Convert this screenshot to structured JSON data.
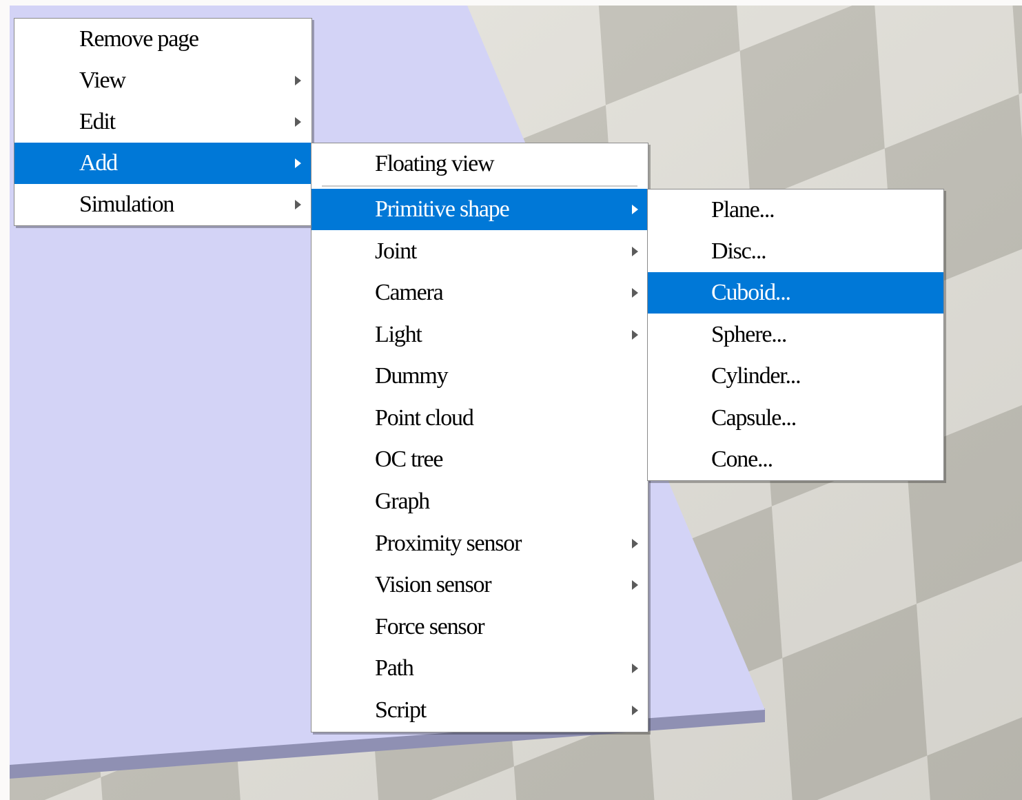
{
  "context_menu": {
    "items": [
      {
        "label": "Remove page",
        "submenu": false,
        "selected": false
      },
      {
        "label": "View",
        "submenu": true,
        "selected": false
      },
      {
        "label": "Edit",
        "submenu": true,
        "selected": false
      },
      {
        "label": "Add",
        "submenu": true,
        "selected": true
      },
      {
        "label": "Simulation",
        "submenu": true,
        "selected": false
      }
    ]
  },
  "add_menu": {
    "top_item": {
      "label": "Floating view",
      "submenu": false,
      "selected": false
    },
    "items": [
      {
        "label": "Primitive shape",
        "submenu": true,
        "selected": true
      },
      {
        "label": "Joint",
        "submenu": true,
        "selected": false
      },
      {
        "label": "Camera",
        "submenu": true,
        "selected": false
      },
      {
        "label": "Light",
        "submenu": true,
        "selected": false
      },
      {
        "label": "Dummy",
        "submenu": false,
        "selected": false
      },
      {
        "label": "Point cloud",
        "submenu": false,
        "selected": false
      },
      {
        "label": "OC tree",
        "submenu": false,
        "selected": false
      },
      {
        "label": "Graph",
        "submenu": false,
        "selected": false
      },
      {
        "label": "Proximity sensor",
        "submenu": true,
        "selected": false
      },
      {
        "label": "Vision sensor",
        "submenu": true,
        "selected": false
      },
      {
        "label": "Force sensor",
        "submenu": false,
        "selected": false
      },
      {
        "label": "Path",
        "submenu": true,
        "selected": false
      },
      {
        "label": "Script",
        "submenu": true,
        "selected": false
      }
    ]
  },
  "primitive_shape_menu": {
    "items": [
      {
        "label": "Plane...",
        "selected": false
      },
      {
        "label": "Disc...",
        "selected": false
      },
      {
        "label": "Cuboid...",
        "selected": true
      },
      {
        "label": "Sphere...",
        "selected": false
      },
      {
        "label": "Cylinder...",
        "selected": false
      },
      {
        "label": "Capsule...",
        "selected": false
      },
      {
        "label": "Cone...",
        "selected": false
      }
    ]
  },
  "colors": {
    "highlight": "#0078d7",
    "plane_surface": "#d3d3f5",
    "plane_edge": "#8e8fb1",
    "floor_light": "#e6e4dc",
    "floor_dark": "#c4c2b9"
  }
}
